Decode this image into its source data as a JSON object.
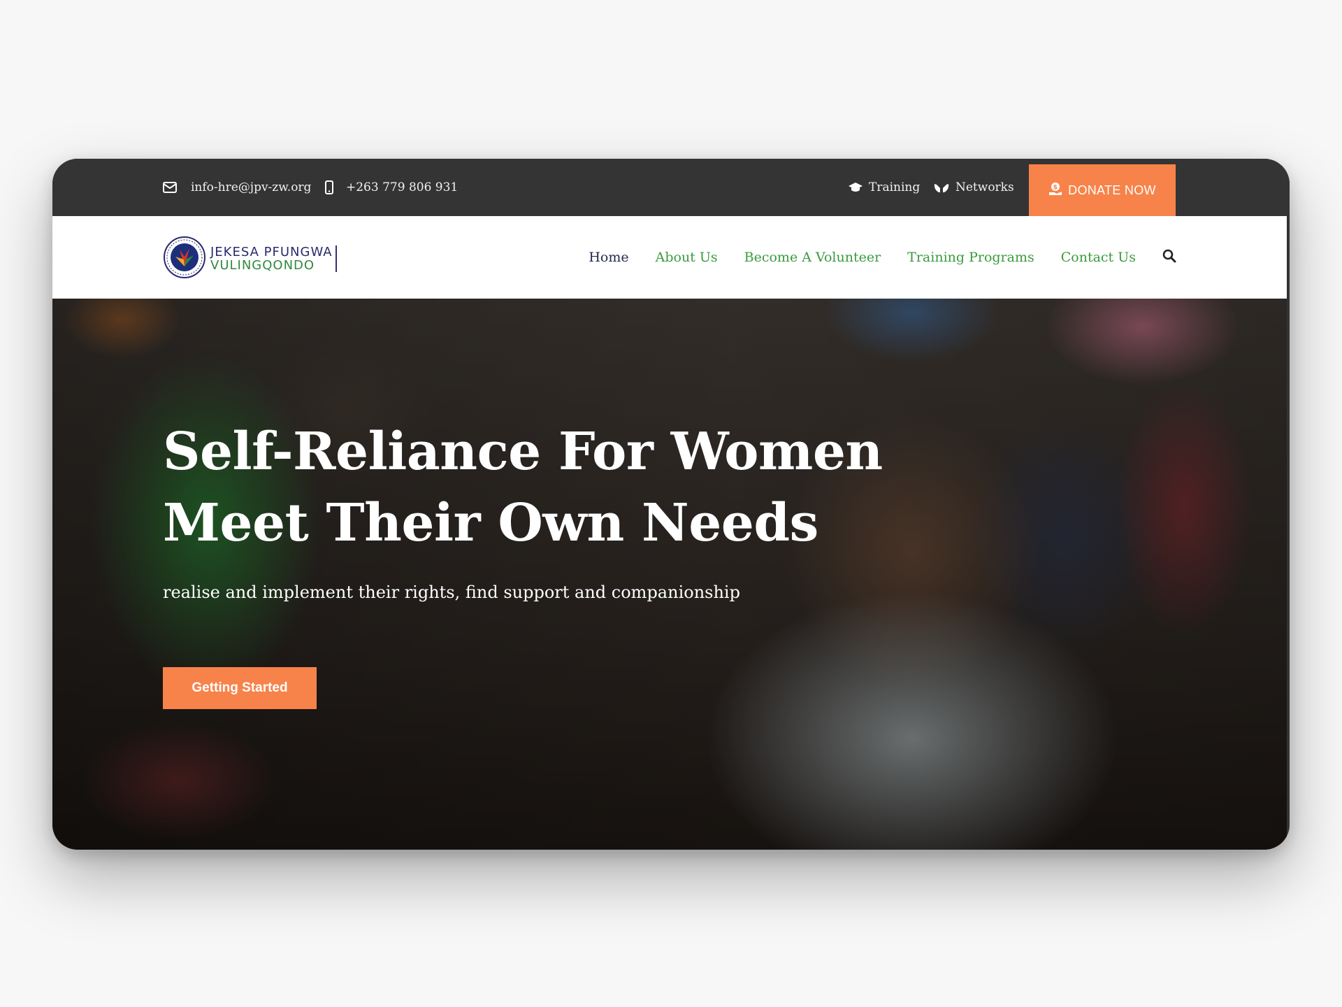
{
  "topbar": {
    "email": "info-hre@jpv-zw.org",
    "email_icon": "envelope-icon",
    "phone": "+263 779 806 931",
    "phone_icon": "mobile-phone-icon",
    "links": [
      {
        "label": "Training",
        "icon": "graduation-cap-icon"
      },
      {
        "label": "Networks",
        "icon": "hands-icon"
      }
    ],
    "donate_label": "DONATE NOW",
    "donate_icon": "donate-icon"
  },
  "logo": {
    "line1": "JEKESA PFUNGWA",
    "line2": "VULINGQONDO"
  },
  "nav": {
    "items": [
      {
        "label": "Home",
        "active": true
      },
      {
        "label": "About Us",
        "active": false
      },
      {
        "label": "Become A Volunteer",
        "active": false
      },
      {
        "label": "Training Programs",
        "active": false
      },
      {
        "label": "Contact Us",
        "active": false
      }
    ],
    "search_icon": "search-icon"
  },
  "hero": {
    "title_line1": "Self-Reliance For Women",
    "title_line2": "Meet Their Own Needs",
    "subtitle": "realise and implement their rights, find support and companionship",
    "cta_label": "Getting Started"
  },
  "colors": {
    "accent": "#f7834a",
    "nav_link": "#3a9a3c",
    "nav_active": "#1f2a4a",
    "topbar_bg": "#343434"
  }
}
